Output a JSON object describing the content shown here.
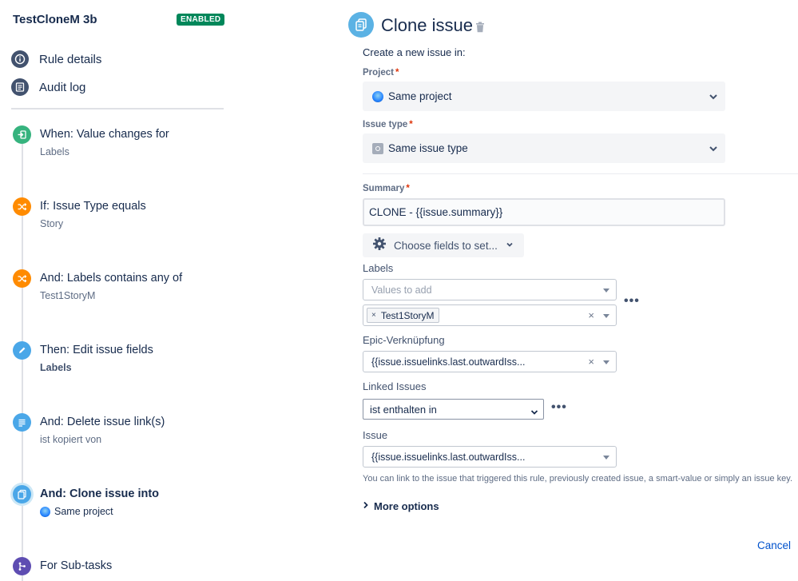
{
  "rule": {
    "name": "TestCloneM 3b",
    "status": "ENABLED"
  },
  "menu": [
    {
      "label": "Rule details",
      "icon": "info-icon"
    },
    {
      "label": "Audit log",
      "icon": "audit-log-icon"
    }
  ],
  "steps": [
    {
      "title": "When: Value changes for",
      "subtitle": "Labels",
      "icon": "trigger-icon",
      "color": "#36b37e"
    },
    {
      "title": "If: Issue Type equals",
      "subtitle": "Story",
      "icon": "condition-icon",
      "color": "#ff8b00"
    },
    {
      "title": "And: Labels contains any of",
      "subtitle": "Test1StoryM",
      "icon": "condition-icon",
      "color": "#ff8b00"
    },
    {
      "title": "Then: Edit issue fields",
      "subtitle": "Labels",
      "icon": "edit-icon",
      "color": "#4aa7e8"
    },
    {
      "title": "And: Delete issue link(s)",
      "subtitle": "ist kopiert von",
      "icon": "delete-link-icon",
      "color": "#4aa7e8"
    },
    {
      "title": "And: Clone issue into",
      "subtitle": "Same project",
      "icon": "clone-icon",
      "color": "#4aa7e8"
    },
    {
      "title": "For Sub-tasks",
      "subtitle": "",
      "icon": "branch-icon",
      "color": "#5e4db2"
    }
  ],
  "panel": {
    "title": "Clone issue",
    "intro": "Create a new issue in:",
    "project": {
      "label": "Project",
      "required": "*",
      "value": "Same project"
    },
    "issue_type": {
      "label": "Issue type",
      "required": "*",
      "value": "Same issue type"
    },
    "summary": {
      "label": "Summary",
      "required": "*",
      "value": "CLONE - {{issue.summary}}"
    },
    "choose_fields": "Choose fields to set...",
    "labels": {
      "label": "Labels",
      "placeholder": "Values to add",
      "tag": "Test1StoryM",
      "tag_remove": "×",
      "clear": "×"
    },
    "epic": {
      "label": "Epic-Verknüpfung",
      "value": "{{issue.issuelinks.last.outwardIss...",
      "clear": "×"
    },
    "linked_issues": {
      "label": "Linked Issues",
      "value": "ist enthalten in"
    },
    "issue": {
      "label": "Issue",
      "value": "{{issue.issuelinks.last.outwardIss..."
    },
    "help": "You can link to the issue that triggered this rule, previously created issue, a smart-value or simply an issue key.",
    "more_options": "More options",
    "more_dots": "•••",
    "cancel": "Cancel"
  },
  "colors": {
    "accent": "#0052cc",
    "enabled": "#00875a",
    "required": "#de350b",
    "clone": "#5bb2e4"
  }
}
